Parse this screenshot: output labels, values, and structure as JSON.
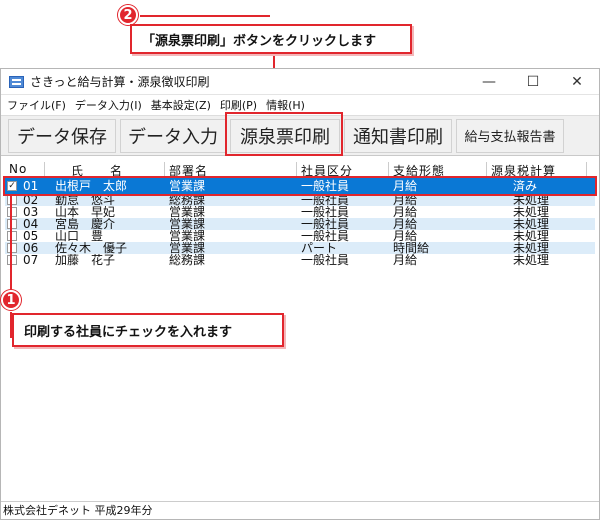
{
  "window": {
    "title": "さきっと給与計算・源泉徴収印刷",
    "minimize": "—",
    "maximize": "☐",
    "close": "✕"
  },
  "menu": [
    "ファイル(F)",
    "データ入力(I)",
    "基本設定(Z)",
    "印刷(P)",
    "情報(H)"
  ],
  "toolbar": {
    "save": "データ保存",
    "input": "データ入力",
    "print_withholding": "源泉票印刷",
    "notice_print": "通知書印刷",
    "report": "給与支払報告書"
  },
  "table": {
    "headers": [
      "No",
      "氏　　名",
      "部署名",
      "社員区分",
      "支給形態",
      "源泉税計算"
    ],
    "rows": [
      {
        "checked": true,
        "no": "01",
        "name": "出根戸　太郎",
        "dept": "営業課",
        "cls": "一般社員",
        "pay": "月給",
        "tax": "済み"
      },
      {
        "checked": false,
        "no": "02",
        "name": "勤怠　悠斗",
        "dept": "総務課",
        "cls": "一般社員",
        "pay": "月給",
        "tax": "未処理"
      },
      {
        "checked": false,
        "no": "03",
        "name": "山本　早妃",
        "dept": "営業課",
        "cls": "一般社員",
        "pay": "月給",
        "tax": "未処理"
      },
      {
        "checked": false,
        "no": "04",
        "name": "宮島　慶介",
        "dept": "営業課",
        "cls": "一般社員",
        "pay": "月給",
        "tax": "未処理"
      },
      {
        "checked": false,
        "no": "05",
        "name": "山口　豊",
        "dept": "営業課",
        "cls": "一般社員",
        "pay": "月給",
        "tax": "未処理"
      },
      {
        "checked": false,
        "no": "06",
        "name": "佐々木　優子",
        "dept": "営業課",
        "cls": "パート",
        "pay": "時間給",
        "tax": "未処理"
      },
      {
        "checked": false,
        "no": "07",
        "name": "加藤　花子",
        "dept": "総務課",
        "cls": "一般社員",
        "pay": "月給",
        "tax": "未処理"
      }
    ]
  },
  "status": "株式会社デネット 平成29年分",
  "annotations": {
    "step2_num": "2",
    "step2_text": "「源泉票印刷」ボタンをクリックします",
    "step1_num": "1",
    "step1_text": "印刷する社員にチェックを入れます",
    "accent": "#e1262d"
  }
}
